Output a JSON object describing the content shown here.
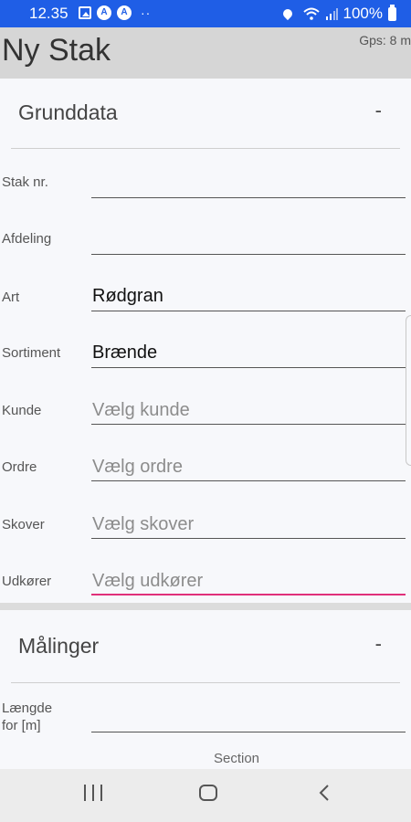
{
  "status_bar": {
    "time": "12.35",
    "battery": "100%",
    "icons": [
      "image-icon",
      "app-icon",
      "app-icon",
      "more-dots-icon",
      "location-icon",
      "wifi-icon",
      "signal-icon",
      "battery-icon"
    ]
  },
  "header": {
    "title": "Ny Stak",
    "gps": "Gps: 8 m"
  },
  "sections": {
    "grunddata": {
      "title": "Grunddata",
      "toggle": "-",
      "fields": [
        {
          "label": "Stak nr.",
          "value": "",
          "placeholder": ""
        },
        {
          "label": "Afdeling",
          "value": "",
          "placeholder": ""
        },
        {
          "label": "Art",
          "value": "Rødgran",
          "placeholder": ""
        },
        {
          "label": "Sortiment",
          "value": "Brænde",
          "placeholder": ""
        },
        {
          "label": "Kunde",
          "value": "",
          "placeholder": "Vælg kunde"
        },
        {
          "label": "Ordre",
          "value": "",
          "placeholder": "Vælg ordre"
        },
        {
          "label": "Skover",
          "value": "",
          "placeholder": "Vælg skover"
        },
        {
          "label": "Udkører",
          "value": "",
          "placeholder": "Vælg udkører"
        }
      ]
    },
    "maalinger": {
      "title": "Målinger",
      "toggle": "-",
      "fields": [
        {
          "label_line1": "Længde",
          "label_line2": "for [m]",
          "value": ""
        }
      ]
    }
  },
  "section_picker": {
    "label": "Section"
  },
  "colors": {
    "status_bar": "#1f5ee6",
    "header": "#d6d6d6",
    "focus_underline": "#e0307a"
  }
}
